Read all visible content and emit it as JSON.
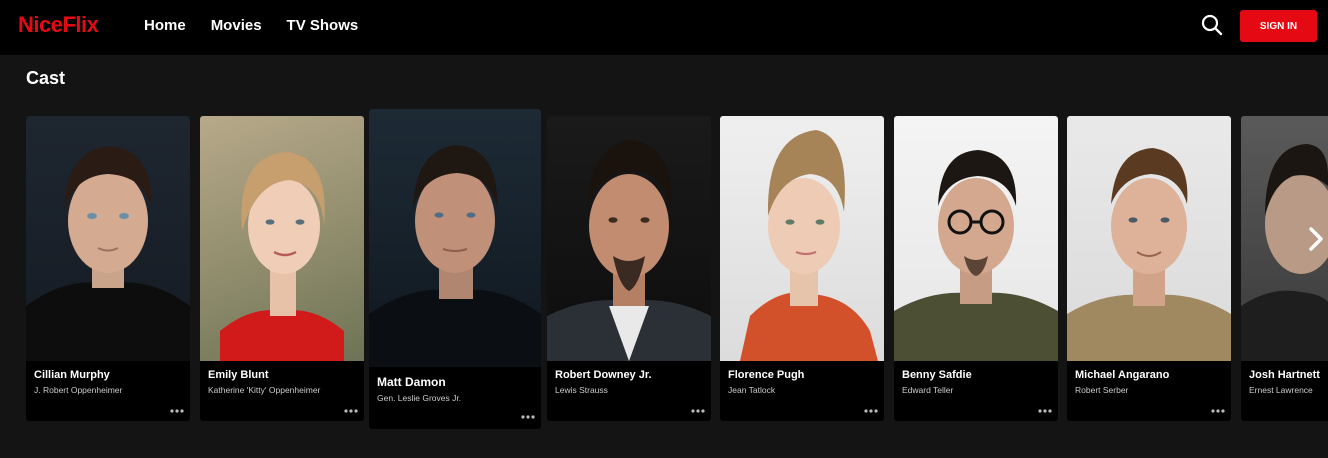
{
  "brand": {
    "logo_text": "NiceFlix",
    "accent": "#e50914"
  },
  "nav": {
    "links": [
      "Home",
      "Movies",
      "TV Shows"
    ],
    "signin_label": "SIGN IN",
    "search_icon": "search-icon"
  },
  "section": {
    "title": "Cast"
  },
  "cast": [
    {
      "name": "Cillian Murphy",
      "role": "J. Robert Oppenheimer"
    },
    {
      "name": "Emily Blunt",
      "role": "Katherine 'Kitty' Oppenheimer"
    },
    {
      "name": "Matt Damon",
      "role": "Gen. Leslie Groves Jr."
    },
    {
      "name": "Robert Downey Jr.",
      "role": "Lewis Strauss"
    },
    {
      "name": "Florence Pugh",
      "role": "Jean Tatlock"
    },
    {
      "name": "Benny Safdie",
      "role": "Edward Teller"
    },
    {
      "name": "Michael Angarano",
      "role": "Robert Serber"
    },
    {
      "name": "Josh Hartnett",
      "role": "Ernest Lawrence"
    }
  ]
}
